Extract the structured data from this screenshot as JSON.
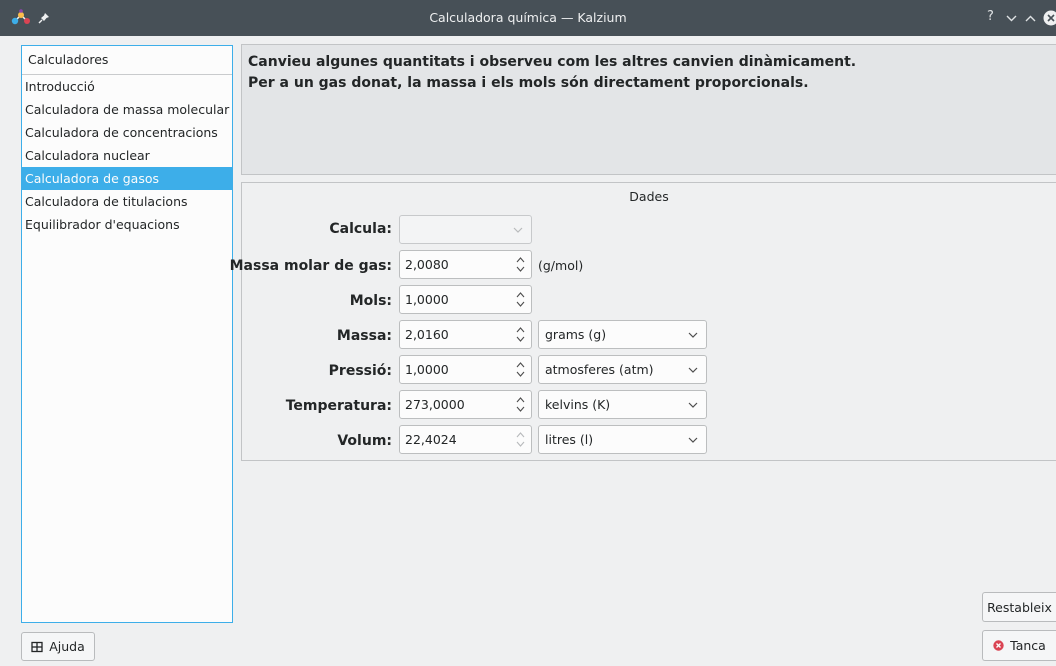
{
  "window": {
    "title": "Calculadora química — Kalzium",
    "controls": {
      "help": "?",
      "minimize": "⌄",
      "maximize": "⌃",
      "close": "×"
    },
    "icons": {
      "app": "kalzium-molecule-icon",
      "pin": "pin-icon"
    }
  },
  "sidebar": {
    "header": "Calculadores",
    "items": [
      {
        "label": "Introducció",
        "selected": false
      },
      {
        "label": "Calculadora de massa molecular",
        "selected": false
      },
      {
        "label": "Calculadora de concentracions",
        "selected": false
      },
      {
        "label": "Calculadora nuclear",
        "selected": false
      },
      {
        "label": "Calculadora de gasos",
        "selected": true
      },
      {
        "label": "Calculadora de titulacions",
        "selected": false
      },
      {
        "label": "Equilibrador d'equacions",
        "selected": false
      }
    ]
  },
  "info": {
    "line1": "Canvieu algunes quantitats i observeu com les altres canvien dinàmicament.",
    "line2": "Per a un gas donat, la massa i els mols són directament proporcionals."
  },
  "data_group": {
    "title": "Dades",
    "calculate": {
      "label": "Calcula:",
      "value": ""
    },
    "molar_mass": {
      "label": "Massa molar de gas:",
      "value": "2,0080",
      "unit": "(g/mol)"
    },
    "moles": {
      "label": "Mols:",
      "value": "1,0000"
    },
    "mass": {
      "label": "Massa:",
      "value": "2,0160",
      "unit": "grams (g)"
    },
    "pressure": {
      "label": "Pressió:",
      "value": "1,0000",
      "unit": "atmosferes (atm)"
    },
    "temperature": {
      "label": "Temperatura:",
      "value": "273,0000",
      "unit": "kelvins (K)"
    },
    "volume": {
      "label": "Volum:",
      "value": "22,4024",
      "unit": "litres (l)"
    }
  },
  "buttons": {
    "help": "Ajuda",
    "reset": "Restableix",
    "close": "Tanca"
  },
  "colors": {
    "accent": "#3daee9",
    "titlebar": "#475057",
    "close_icon": "#da4453"
  }
}
